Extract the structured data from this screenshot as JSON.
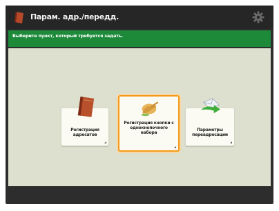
{
  "header": {
    "title": "Парам. адр./передд."
  },
  "instruction": "Выберите пункт, который требуется задать.",
  "buttons": [
    {
      "label": "Регистрация адресатов",
      "icon": "address-book-icon",
      "selected": false
    },
    {
      "label": "Регистрация кнопки с однокнопочного набора",
      "icon": "one-touch-hand-icon",
      "selected": true
    },
    {
      "label": "Параметры переадресации",
      "icon": "forward-envelope-icon",
      "selected": false
    }
  ],
  "colors": {
    "accent": "#1d8a3a",
    "selection": "#f39a1b",
    "panel": "#dde0cf"
  }
}
